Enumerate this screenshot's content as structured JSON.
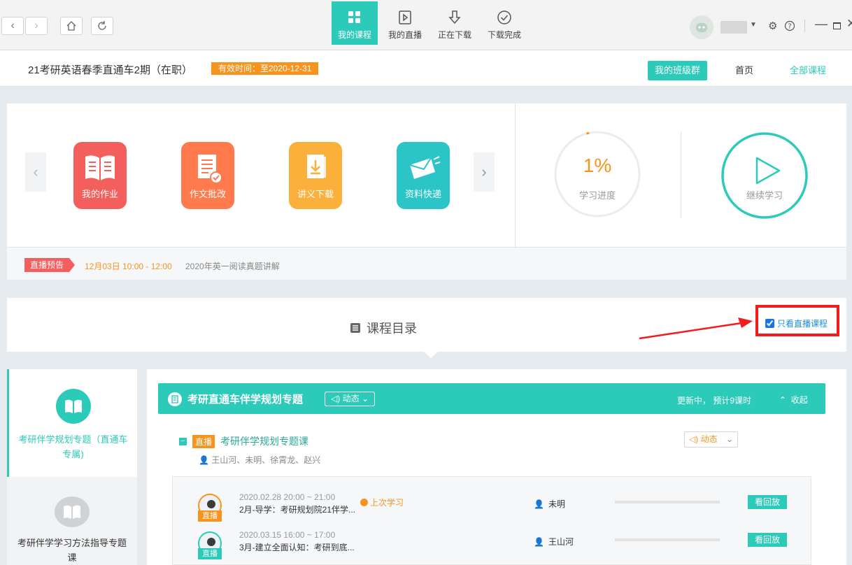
{
  "toolbar": {
    "tabs": [
      {
        "label": "我的课程",
        "icon": "grid-icon",
        "active": true
      },
      {
        "label": "我的直播",
        "icon": "play-box-icon",
        "active": false
      },
      {
        "label": "正在下载",
        "icon": "download-arrow-icon",
        "active": false
      },
      {
        "label": "下载完成",
        "icon": "check-circle-icon",
        "active": false
      }
    ]
  },
  "header": {
    "course_title": "21考研英语春季直通车2期（在职）",
    "validity": "有效时间：至2020-12-31",
    "class_group_button": "我的班级群",
    "home_link": "首页",
    "all_courses_link": "全部课程"
  },
  "features": [
    {
      "label": "我的作业",
      "icon": "open-book-icon",
      "color": "#f25f5c"
    },
    {
      "label": "作文批改",
      "icon": "document-check-icon",
      "color": "#ff7a4d"
    },
    {
      "label": "讲义下载",
      "icon": "download-file-icon",
      "color": "#fbb03b"
    },
    {
      "label": "资料快递",
      "icon": "envelope-fly-icon",
      "color": "#2bc4c7"
    }
  ],
  "study": {
    "progress_value": "1%",
    "progress_fraction": 0.01,
    "progress_label": "学习进度",
    "continue_label": "继续学习"
  },
  "live_preview": {
    "tag": "直播预告",
    "time": "12月03日 10:00 - 12:00",
    "topic": "2020年英一阅读真题讲解"
  },
  "catalog": {
    "title": "课程目录",
    "filter_label": "只看直播课程",
    "filter_checked": true
  },
  "modules": [
    {
      "label": "考研伴学规划专题（直通车专属)",
      "active": true
    },
    {
      "label": "考研伴学学习方法指导专题课",
      "active": false
    }
  ],
  "topic": {
    "title": "考研直通车伴学规划专题",
    "dynamic": "动态",
    "status": "更新中，  预计9课时",
    "collapse": "收起"
  },
  "course": {
    "tag": "直播",
    "name": "考研伴学规划专题课",
    "teachers": "王山河、未明、徐霄龙、赵兴",
    "dynamic": "动态"
  },
  "lessons": [
    {
      "badge": "直播",
      "time": "2020.02.28 20:00 ~ 21:00",
      "name": "2月-导学：考研规划院21伴学...",
      "last_study": "上次学习",
      "teacher": "未明",
      "replay": "看回放",
      "progress": 0
    },
    {
      "badge": "直播",
      "time": "2020.03.15 16:00 ~ 17:00",
      "name": "3月-建立全面认知：考研到底...",
      "last_study": "",
      "teacher": "王山河",
      "replay": "看回放",
      "progress": 0
    }
  ],
  "colors": {
    "accent": "#2ccbb9",
    "orange": "#f7941d",
    "red": "#f21c1c"
  }
}
